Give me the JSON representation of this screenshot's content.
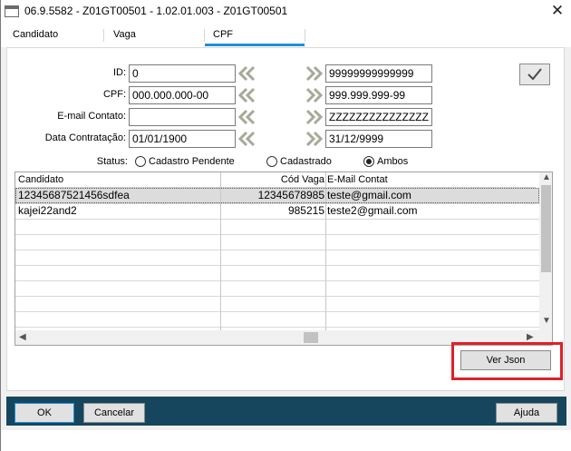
{
  "window": {
    "title": "06.9.5582 - Z01GT00501 - 1.02.01.003 - Z01GT00501",
    "close_glyph": "✕"
  },
  "tabs": [
    {
      "label": "Candidato"
    },
    {
      "label": "Vaga"
    },
    {
      "label": "CPF"
    }
  ],
  "filters": {
    "id": {
      "label": "ID:",
      "from": "0",
      "to": "99999999999999"
    },
    "cpf": {
      "label": "CPF:",
      "from": "000.000.000-00",
      "to": "999.999.999-99"
    },
    "email": {
      "label": "E-mail Contato:",
      "from": "",
      "to": "ZZZZZZZZZZZZZZZ"
    },
    "data": {
      "label": "Data Contratação:",
      "from": "01/01/1900",
      "to": "31/12/9999"
    }
  },
  "status": {
    "label": "Status:",
    "options": [
      {
        "label": "Cadastro Pendente",
        "checked": false
      },
      {
        "label": "Cadastrado",
        "checked": false
      },
      {
        "label": "Ambos",
        "checked": true
      }
    ]
  },
  "grid": {
    "columns": [
      "Candidato",
      "Cód Vaga",
      "E-Mail Contat"
    ],
    "rows": [
      {
        "candidato": "12345687521456sdfea",
        "cod_vaga": "12345678985",
        "email": "teste@gmail.com"
      },
      {
        "candidato": "kajei22and2",
        "cod_vaga": "985215",
        "email": "teste2@gmail.com"
      }
    ]
  },
  "buttons": {
    "ver_json": "Ver Json",
    "ok": "OK",
    "cancelar": "Cancelar",
    "ajuda": "Ajuda"
  },
  "icons": {
    "confirm": "checkmark-icon",
    "range_from": "double-chevron-left-icon",
    "range_to": "double-chevron-right-icon"
  },
  "colors": {
    "tab_accent": "#1e90d8",
    "bottom_bar": "#16465e",
    "highlight": "#e0202a",
    "chevron": "#a8a89a"
  }
}
